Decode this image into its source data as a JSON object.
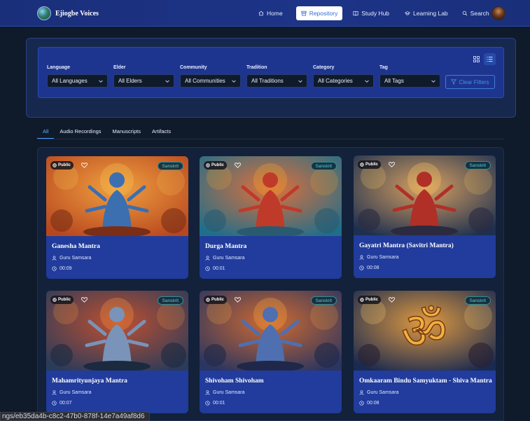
{
  "app": {
    "brand_name": "Ejiogbe Voices"
  },
  "nav": {
    "items": [
      {
        "label": "Home",
        "icon": "home-icon",
        "active": false
      },
      {
        "label": "Repository",
        "icon": "archive-icon",
        "active": true
      },
      {
        "label": "Study Hub",
        "icon": "book-icon",
        "active": false
      },
      {
        "label": "Learning Lab",
        "icon": "graduation-cap-icon",
        "active": false
      },
      {
        "label": "Search",
        "icon": "search-icon",
        "active": false
      }
    ]
  },
  "filters": {
    "groups": [
      {
        "label": "Language",
        "value": "All Languages"
      },
      {
        "label": "Elder",
        "value": "All Elders"
      },
      {
        "label": "Community",
        "value": "All Communities"
      },
      {
        "label": "Tradition",
        "value": "All Traditions"
      },
      {
        "label": "Category",
        "value": "All Categories"
      },
      {
        "label": "Tag",
        "value": "All Tags"
      }
    ],
    "clear_label": "Clear Filters",
    "view_modes": [
      "grid-view-icon",
      "list-view-icon"
    ]
  },
  "tabs": [
    {
      "label": "All",
      "active": true
    },
    {
      "label": "Audio Recordings",
      "active": false
    },
    {
      "label": "Manuscripts",
      "active": false
    },
    {
      "label": "Artifacts",
      "active": false
    }
  ],
  "cards": [
    {
      "title": "Ganesha Mantra",
      "visibility": "Public",
      "language": "Sanskrit",
      "elder": "Guru Samsara",
      "duration": "00:09",
      "image": "ganesha-illustration"
    },
    {
      "title": "Durga Mantra",
      "visibility": "Public",
      "language": "Sanskrit",
      "elder": "Guru Samsara",
      "duration": "00:01",
      "image": "durga-illustration"
    },
    {
      "title": "Gayatri Mantra (Savitri Mantra)",
      "visibility": "Public",
      "language": "Sanskrit",
      "elder": "Guru Samsara",
      "duration": "00:08",
      "image": "gayatri-illustration"
    },
    {
      "title": "Mahamrityunjaya Mantra",
      "visibility": "Public",
      "language": "Sanskrit",
      "elder": "Guru Samsara",
      "duration": "00:07",
      "image": "shiva-illustration"
    },
    {
      "title": "Shivoham Shivoham",
      "visibility": "Public",
      "language": "Sanskrit",
      "elder": "Guru Samsara",
      "duration": "00:01",
      "image": "shivoham-illustration"
    },
    {
      "title": "Omkaaram Bindu Samyuktam - Shiva Mantra",
      "visibility": "Public",
      "language": "Sanskrit",
      "elder": "Guru Samsara",
      "duration": "00:08",
      "image": "om-illustration"
    }
  ],
  "status_bar": {
    "url": "ngs/eb35da4b-c8c2-47b0-878f-14e7a49af8d6"
  },
  "colors": {
    "accent": "#4aa2ff",
    "card_body": "#213c9c",
    "nav_bg": "#1d3488",
    "badge_teal": "#53d0db"
  }
}
